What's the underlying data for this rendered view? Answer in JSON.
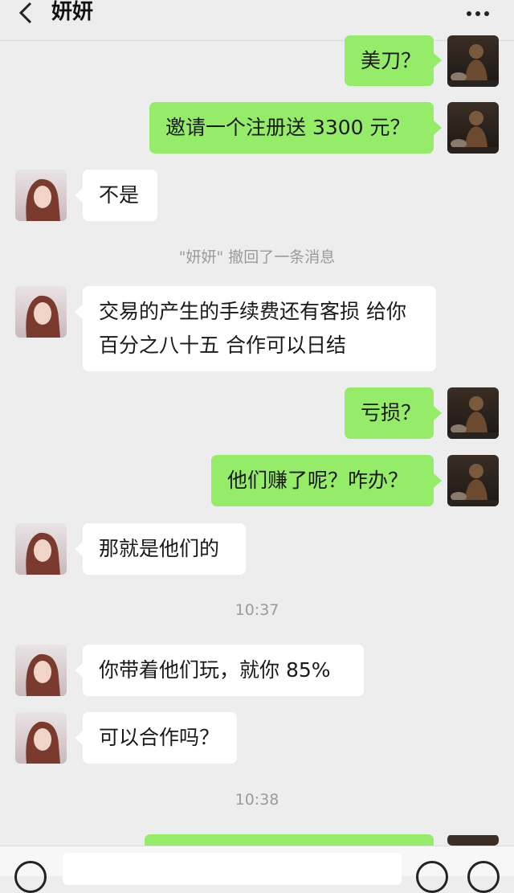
{
  "header": {
    "back_icon": "chevron-left-icon",
    "title": "妍妍",
    "more_icon": "more-dots-icon"
  },
  "messages": [
    {
      "side": "out",
      "text": "美刀？"
    },
    {
      "side": "out",
      "text": "邀请一个注册送 3300 元？"
    },
    {
      "side": "in",
      "text": "不是"
    },
    {
      "side": "system",
      "text": "\"妍妍\" 撤回了一条消息"
    },
    {
      "side": "in",
      "text": "交易的产生的手续费还有客损 给你百分之八十五 合作可以日结"
    },
    {
      "side": "out",
      "text": "亏损？"
    },
    {
      "side": "out",
      "text": "他们赚了呢？咋办？"
    },
    {
      "side": "in",
      "text": "那就是他们的"
    },
    {
      "side": "time",
      "text": "10:37"
    },
    {
      "side": "in",
      "text": "你带着他们玩，就你 85%"
    },
    {
      "side": "in",
      "text": "可以合作吗？"
    },
    {
      "side": "time",
      "text": "10:38"
    }
  ],
  "input_bar": {
    "voice_icon": "voice-icon",
    "emoji_icon": "emoji-icon",
    "plus_icon": "plus-icon"
  },
  "colors": {
    "background": "#ededed",
    "outgoing_bubble": "#95ec69",
    "incoming_bubble": "#ffffff",
    "system_text": "#9b9b9b"
  }
}
